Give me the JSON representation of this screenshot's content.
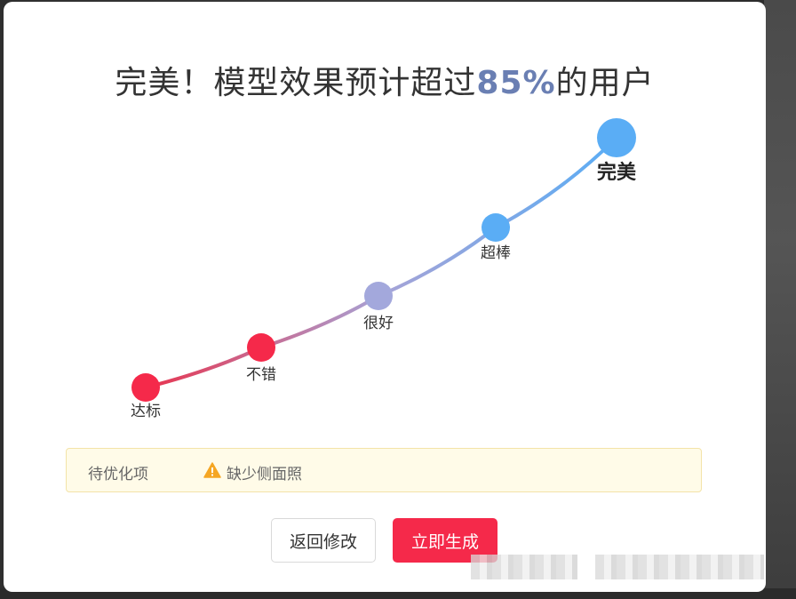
{
  "dialog": {
    "title_prefix": "完美！模型效果预计超过",
    "title_highlight": "85%",
    "title_suffix": "的用户"
  },
  "chart_data": {
    "type": "line",
    "series": [
      {
        "points": [
          {
            "label": "达标",
            "level": 1
          },
          {
            "label": "不错",
            "level": 2
          },
          {
            "label": "很好",
            "level": 3
          },
          {
            "label": "超棒",
            "level": 4
          },
          {
            "label": "完美",
            "level": 5
          }
        ]
      }
    ],
    "current_level": "完美",
    "colors": {
      "start": "#f5294a",
      "mid": "#a3a8dc",
      "end": "#5aadf5"
    }
  },
  "pending": {
    "label": "待优化项",
    "icon": "warning-icon",
    "item": "缺少侧面照"
  },
  "buttons": {
    "back_label": "返回修改",
    "generate_label": "立即生成"
  },
  "colors": {
    "accent": "#f5294a",
    "title_highlight": "#6a7fb3",
    "warning": "#f5a623"
  }
}
